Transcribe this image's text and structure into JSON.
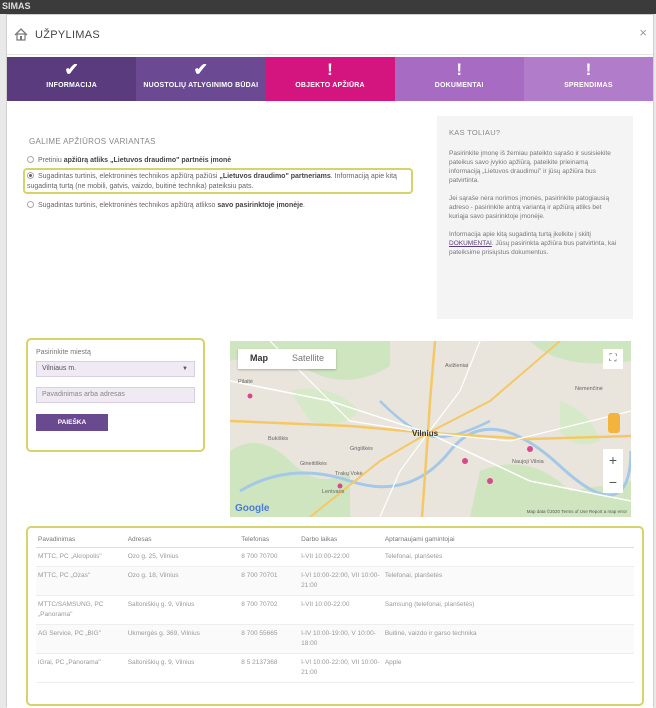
{
  "os": {
    "title": "SIMAS"
  },
  "window": {
    "title": "UŽPYLIMAS",
    "close": "×"
  },
  "steps": [
    {
      "mark": "✔",
      "label": "INFORMACIJA"
    },
    {
      "mark": "✔",
      "label": "NUOSTOLIŲ ATLYGINIMO BŪDAI"
    },
    {
      "mark": "!",
      "label": "OBJEKTO APŽIŪRA"
    },
    {
      "mark": "!",
      "label": "DOKUMENTAI"
    },
    {
      "mark": "!",
      "label": "SPRENDIMAS"
    }
  ],
  "choose": {
    "heading": "GALIME APŽIŪROS VARIANTAS",
    "options": [
      {
        "pre": "Pretiniu ",
        "bold": "apžiūrą atliks „Lietuvos draudimo\" partnėis įmonė",
        "post": "",
        "selected": false
      },
      {
        "pre": "Sugadintas turtinis, elektroninės technikos apžiūrą pažiūsi ",
        "bold": "„Lietuvos draudimo\" partneriams",
        "post": ". Informaciją apie kitą sugadintą turtą (ne mobili, gatvis, vaizdo, buitinė technika) pateiksiu pats.",
        "selected": true
      },
      {
        "pre": "Sugadintas turtinis, elektroninės technikos apžiūrą atlikso ",
        "bold": "savo pasirinktoje įmonėje",
        "post": ".",
        "selected": false
      }
    ]
  },
  "info": {
    "heading": "KAS TOLIAU?",
    "p1": "Pasirinkite įmonę iš žemiau pateikto sąrašo ir susisiekite pateikus savo įvykio apžiūrą, pateikite prieinamą informaciją „Lietuvos draudimui\" ir jūsų apžiūra bus patvirtinta.",
    "p2": "Jei sąraše nėra norimos įmonės, pasirinkite patogiausią adreso - pasirinkite antrą variantą ir apžiūrą atliks bet kuriąja savo pasirinktoje įmonėje.",
    "p3a": "Informacija apie kitą sugadintą turtą įkelkite į skiltį ",
    "p3link": "DOKUMENTAI",
    "p3b": ". Jūsų pasirinkta apžiūra bus patvirtinta, kai pateiksime prisiųstus dokumentus."
  },
  "search": {
    "label": "Pasirinkite miestą",
    "city": "Vilniaus m.",
    "placeholder": "Pavadinimas arba adresas",
    "button": "PAIEŠKA"
  },
  "map": {
    "tab_map": "Map",
    "tab_satellite": "Satellite",
    "city": "Vilnius",
    "places": [
      "Pilaitė",
      "Bukiškis",
      "Gineitiškės",
      "Lentvaris",
      "Trakų Vokė",
      "Grigiškės",
      "Avižieniai",
      "Nemenčinė",
      "Naujoji Vilnia"
    ],
    "credits": "Map data ©2020   Terms of Use   Report a map error",
    "google": "Google"
  },
  "table": {
    "headers": [
      "Pavadinimas",
      "Adresas",
      "Telefonas",
      "Darbo laikas",
      "Aptarnaujami gamintojai"
    ],
    "rows": [
      [
        "MTTC, PC „Akropolis\"",
        "Ozo g. 25, Vilnius",
        "8 700 70700",
        "I-VII 10:00-22:00",
        "Telefonai, planšetės"
      ],
      [
        "MTTC, PC „Ozas\"",
        "Ozo g. 18, Vilnius",
        "8 700 70701",
        "I-VI 10:00-22:00, VII 10:00-21:00",
        "Telefonai, planšetės"
      ],
      [
        "MTTC/SAMSUNG, PC „Panorama\"",
        "Saltoniškių g. 9, Vilnius",
        "8 700 70702",
        "I-VII 10:00-22:00",
        "Samsung (telefonai, planšetės)"
      ],
      [
        "AG Service, PC „BIG\"",
        "Ukmergės g. 369, Vilnius",
        "8 700 55665",
        "I-IV 10:00-19:00, V 10:00-18:00",
        "Buitinė, vaizdo ir garso technika"
      ],
      [
        "iGrai, PC „Panorama\"",
        "Saltoniškių g. 9, Vilnius",
        "8 5 2137368",
        "I-VI 10:00-22:00, VII 10:00-21:00",
        "Apple"
      ]
    ]
  },
  "colors": {
    "primary": "#5a3c7e",
    "accent": "#d5157f",
    "highlight": "#d6d36b"
  }
}
